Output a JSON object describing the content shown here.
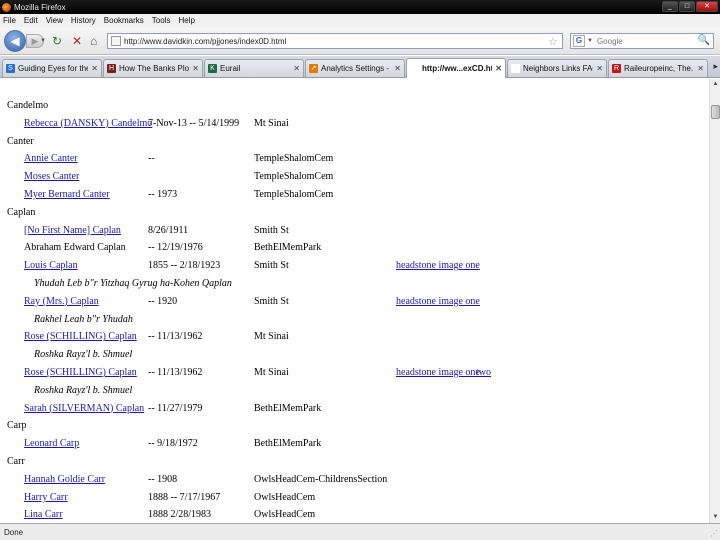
{
  "window": {
    "title": "Mozilla Firefox",
    "minimize": "_",
    "maximize": "□",
    "close": "✕"
  },
  "menu": [
    "File",
    "Edit",
    "View",
    "History",
    "Bookmarks",
    "Tools",
    "Help"
  ],
  "nav": {
    "back": "◀",
    "forward": "▶",
    "history_drop": "▼",
    "reload": "↻",
    "stop": "✕",
    "home": "⌂",
    "url": "http://www.davidkin.com/pjjones/index0D.html",
    "star": "☆",
    "search_engine": "G",
    "search_drop": "▼",
    "search_placeholder": "Google",
    "search_go": "🔍"
  },
  "tabs": [
    {
      "label": "Guiding Eyes for the B...",
      "icon": "S",
      "icon_color": "#2a6fc9",
      "close": "✕",
      "active": false
    },
    {
      "label": "How The Banks Plotte...",
      "icon": "H",
      "icon_color": "#7b1f1f",
      "close": "✕",
      "active": false
    },
    {
      "label": "Eurail",
      "icon": "K",
      "icon_color": "#1d6b40",
      "close": "✕",
      "active": false
    },
    {
      "label": "Analytics Settings - G...",
      "icon": "↗",
      "icon_color": "#e07b00",
      "close": "✕",
      "active": false
    },
    {
      "label": "http://ww...exCD.html",
      "icon": "",
      "icon_color": "#ffffff",
      "close": "✕",
      "active": true
    },
    {
      "label": "Neighbors Links FAQ",
      "icon": "",
      "icon_color": "#ffffff",
      "close": "✕",
      "active": false
    },
    {
      "label": "Raileuropeinc, The...",
      "icon": "R",
      "icon_color": "#c01818",
      "close": "✕",
      "active": false
    }
  ],
  "tab_scroll": "▸",
  "scroll": {
    "up": "▲",
    "down": "▼"
  },
  "records": [
    {
      "type": "surname",
      "text": "Candelmo"
    },
    {
      "type": "person",
      "name": "Rebecca (DANSKY) Candelmo",
      "dates": "7-Nov-13 -- 5/14/1999",
      "loc": "Mt Sinai"
    },
    {
      "type": "surname",
      "text": "Canter"
    },
    {
      "type": "person",
      "name": "Annie Canter",
      "dates": "--",
      "loc": "TempleShalomCem"
    },
    {
      "type": "person",
      "name": "Moses Canter",
      "dates": "",
      "loc": "TempleShalomCem"
    },
    {
      "type": "person",
      "name": "Myer Bernard Canter",
      "dates": "-- 1973",
      "loc": "TempleShalomCem"
    },
    {
      "type": "surname",
      "text": "Caplan"
    },
    {
      "type": "person",
      "name": "[No First Name] Caplan",
      "dates": "8/26/1911",
      "loc": "Smith St"
    },
    {
      "type": "person",
      "name": "Abraham Edward Caplan",
      "dates": "-- 12/19/1976",
      "loc": "BethElMemPark",
      "plainname": true
    },
    {
      "type": "person",
      "name": "Louis Caplan",
      "dates": "1855 -- 2/18/1923",
      "loc": "Smith St",
      "link1": "headstone image one"
    },
    {
      "type": "hebrew",
      "text": "Yhudah Leb b\"r Yitzhaq Gyrug ha-Kohen Qaplan"
    },
    {
      "type": "person",
      "name": "Ray (Mrs.) Caplan",
      "dates": "-- 1920",
      "loc": "Smith St",
      "link1": "headstone image one"
    },
    {
      "type": "hebrew",
      "text": "Rakhel Leah b\"r Yhudah"
    },
    {
      "type": "person",
      "name": "Rose (SCHILLING) Caplan",
      "dates": "-- 11/13/1962",
      "loc": "Mt Sinai"
    },
    {
      "type": "hebrew",
      "text": "Roshka Rayz'l b. Shmuel"
    },
    {
      "type": "person",
      "name": "Rose (SCHILLING) Caplan",
      "dates": "-- 11/13/1962",
      "loc": "Mt Sinai",
      "link1": "headstone image one",
      "link2": "two"
    },
    {
      "type": "hebrew",
      "text": "Roshka Rayz'l b. Shmuel"
    },
    {
      "type": "person",
      "name": "Sarah (SILVERMAN) Caplan",
      "dates": "-- 11/27/1979",
      "loc": "BethElMemPark"
    },
    {
      "type": "surname",
      "text": "Carp"
    },
    {
      "type": "person",
      "name": "Leonard Carp",
      "dates": "-- 9/18/1972",
      "loc": "BethElMemPark"
    },
    {
      "type": "surname",
      "text": "Carr"
    },
    {
      "type": "person",
      "name": "Hannah Goldie Carr",
      "dates": "-- 1908",
      "loc": "OwlsHeadCem-ChildrensSection"
    },
    {
      "type": "person",
      "name": "Harry Carr",
      "dates": "1888 -- 7/17/1967",
      "loc": "OwlsHeadCem"
    },
    {
      "type": "person",
      "name": "Lina Carr",
      "dates": "1888   2/28/1983",
      "loc": "OwlsHeadCem"
    }
  ],
  "status": {
    "text": "Done",
    "grip": "⋰"
  }
}
